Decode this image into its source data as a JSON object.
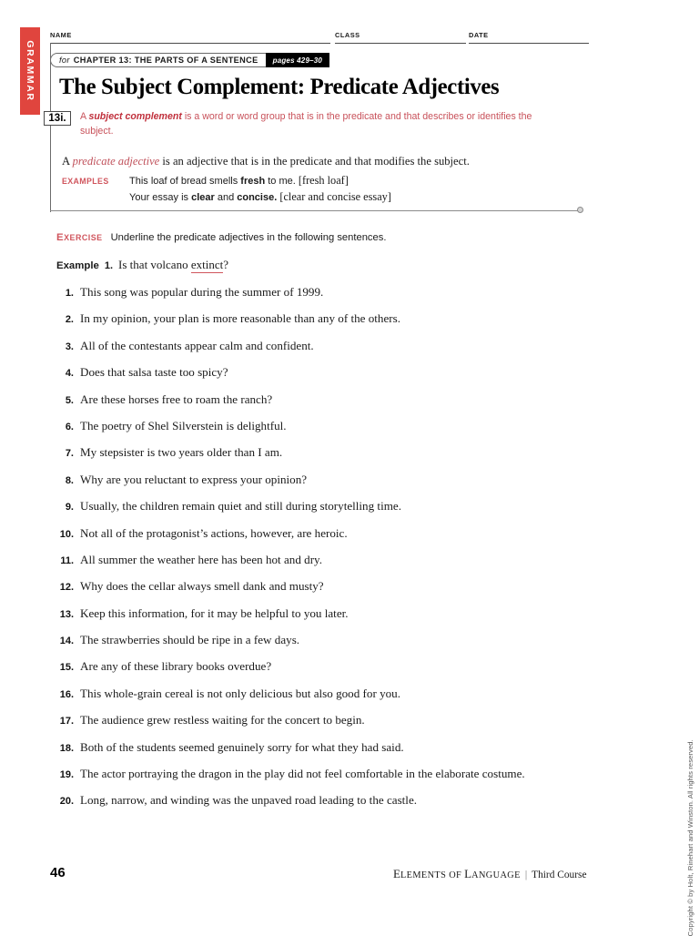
{
  "colors": {
    "accent_red": "#e0453e",
    "rule_text_red": "#c8515a",
    "label_red": "#d0555d",
    "frame_gray": "#6b6b6b"
  },
  "side_tab": {
    "label": "GRAMMAR"
  },
  "header": {
    "name_label": "NAME",
    "class_label": "CLASS",
    "date_label": "DATE"
  },
  "banner": {
    "for_word": "for",
    "chapter": "CHAPTER 13: THE PARTS OF A SENTENCE",
    "pages": "pages 429–30"
  },
  "title": "The Subject Complement: Predicate Adjectives",
  "rule": {
    "number": "13i.",
    "text_lead": "A ",
    "text_em": "subject complement",
    "text_rest": " is a word or word group that is in the predicate and that describes or identifies the subject."
  },
  "definition": {
    "lead": "A ",
    "em": "predicate adjective",
    "rest": " is an adjective that is in the predicate and that modifies the subject."
  },
  "examples": {
    "label": "EXAMPLES",
    "items": [
      {
        "before": "This loaf of bread smells ",
        "bold": "fresh",
        "after": " to me. ",
        "bracket": "[fresh loaf]"
      },
      {
        "before": "Your essay is ",
        "bold": "clear",
        "mid": " and ",
        "bold2": "concise.",
        "after": " ",
        "bracket": "[clear and concise essay]"
      }
    ]
  },
  "exercise": {
    "label_cap": "E",
    "label_rest": "XERCISE",
    "instruction": "Underline the predicate adjectives in the following sentences."
  },
  "example_item": {
    "label": "Example",
    "number": "1.",
    "before": "Is that volcano ",
    "underlined": "extinct",
    "after": "?"
  },
  "items": [
    {
      "n": "1.",
      "s": "This song was popular during the summer of 1999."
    },
    {
      "n": "2.",
      "s": "In my opinion, your plan is more reasonable than any of the others."
    },
    {
      "n": "3.",
      "s": "All of the contestants appear calm and confident."
    },
    {
      "n": "4.",
      "s": "Does that salsa taste too spicy?"
    },
    {
      "n": "5.",
      "s": "Are these horses free to roam the ranch?"
    },
    {
      "n": "6.",
      "s": "The poetry of Shel Silverstein is delightful."
    },
    {
      "n": "7.",
      "s": "My stepsister is two years older than I am."
    },
    {
      "n": "8.",
      "s": "Why are you reluctant to express your opinion?"
    },
    {
      "n": "9.",
      "s": "Usually, the children remain quiet and still during storytelling time."
    },
    {
      "n": "10.",
      "s": "Not all of the protagonist’s actions, however, are heroic."
    },
    {
      "n": "11.",
      "s": "All summer the weather here has been hot and dry."
    },
    {
      "n": "12.",
      "s": "Why does the cellar always smell dank and musty?"
    },
    {
      "n": "13.",
      "s": "Keep this information, for it may be helpful to you later."
    },
    {
      "n": "14.",
      "s": "The strawberries should be ripe in a few days."
    },
    {
      "n": "15.",
      "s": "Are any of these library books overdue?"
    },
    {
      "n": "16.",
      "s": "This whole-grain cereal is not only delicious but also good for you."
    },
    {
      "n": "17.",
      "s": "The audience grew restless waiting for the concert to begin."
    },
    {
      "n": "18.",
      "s": "Both of the students seemed genuinely sorry for what they had said."
    },
    {
      "n": "19.",
      "s": "The actor portraying the dragon in the play did not feel comfortable in the elaborate costume."
    },
    {
      "n": "20.",
      "s": "Long, narrow, and winding was the unpaved road leading to the castle."
    }
  ],
  "copyright": "Copyright © by Holt, Rinehart and Winston. All rights reserved.",
  "footer": {
    "page_number": "46",
    "book_e": "E",
    "book_lements": "LEMENTS OF ",
    "book_l": "L",
    "book_anguage": "ANGUAGE",
    "separator": "|",
    "course": "Third Course"
  }
}
